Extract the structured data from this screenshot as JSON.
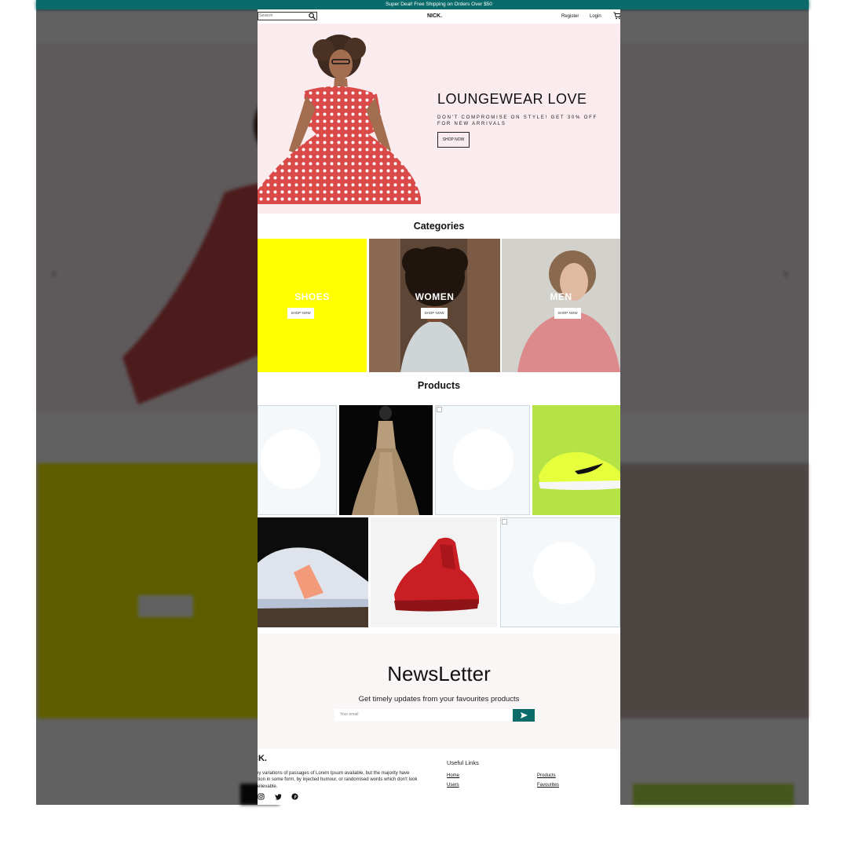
{
  "announcement": "Super Deal! Free Shipping on Orders Over $50",
  "colors": {
    "accent": "#0b6a6a",
    "hero_bg": "#f9ebee",
    "shoes_bg": "#ffff00",
    "newsletter_bg": "#fbf6f6"
  },
  "nav": {
    "search_placeholder": "Search",
    "logo": "NICK.",
    "register": "Register",
    "login": "Login",
    "search_icon": "search-icon",
    "cart_icon": "cart-icon"
  },
  "hero": {
    "title": "LOUNGEWEAR LOVE",
    "subtitle": "DON'T COMPROMISE ON STYLE! GET 30% OFF FOR NEW ARRIVALS",
    "button": "SHOP NOW"
  },
  "categories": {
    "title": "Categories",
    "items": [
      {
        "title": "SHOES",
        "button": "SHOP NOW"
      },
      {
        "title": "WOMEN",
        "button": "SHOP NOW"
      },
      {
        "title": "MEN",
        "button": "SHOP NOW"
      }
    ]
  },
  "products": {
    "title": "Products"
  },
  "newsletter": {
    "title": "NewsLetter",
    "subtitle": "Get timely updates from your favourites products",
    "placeholder": "Your email",
    "send_icon": "send-icon"
  },
  "footer": {
    "logo": "NICK.",
    "description": "There are many variations of passages of Lorem Ipsum available, but the majority have suffered alteration in some form, by injected humour, or randomised words which don't look even slightly believable.",
    "social": [
      "instagram-icon",
      "twitter-icon",
      "pinterest-icon"
    ],
    "useful_links_title": "Useful Links",
    "links": [
      "Home",
      "Products",
      "Users",
      "Favourites"
    ]
  }
}
